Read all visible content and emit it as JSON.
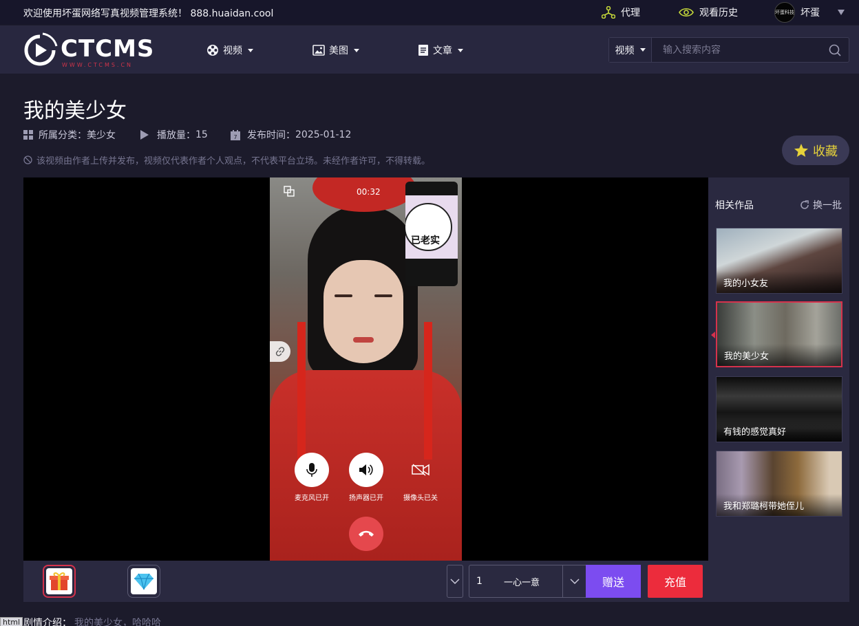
{
  "topbar": {
    "welcome": "欢迎使用坏蛋网络写真视频管理系统！ 888.huaidan.cool",
    "agent_label": "代理",
    "history_label": "观看历史",
    "username": "坏蛋",
    "avatar_text": "坏蛋科技"
  },
  "nav": {
    "logo_text": "CTCMS",
    "logo_sub": "WWW.CTCMS.CN",
    "items": [
      {
        "label": "视频",
        "icon": "film-reel-icon"
      },
      {
        "label": "美图",
        "icon": "image-icon"
      },
      {
        "label": "文章",
        "icon": "document-icon"
      }
    ],
    "search": {
      "type": "视频",
      "placeholder": "输入搜索内容"
    }
  },
  "video": {
    "title": "我的美少女",
    "category_label": "所属分类：",
    "category": "美少女",
    "plays_label": "播放量：",
    "plays": "15",
    "date_label": "发布时间：",
    "date": "2025-01-12",
    "notice": "该视频由作者上传并发布，视频仅代表作者个人观点，不代表平台立场。未经作者许可，不得转载。",
    "favorite": "收藏"
  },
  "player": {
    "timer": "00:32",
    "sticker_text": "已老实",
    "controls": [
      {
        "label": "麦克风已开",
        "icon": "microphone-icon"
      },
      {
        "label": "扬声器已开",
        "icon": "speaker-icon"
      },
      {
        "label": "摄像头已关",
        "icon": "camera-off-icon"
      }
    ]
  },
  "gift_bar": {
    "quantity": "1",
    "quantity_word": "一心一意",
    "send": "赠送",
    "recharge": "充值"
  },
  "sidebar": {
    "heading": "相关作品",
    "refresh": "换一批",
    "items": [
      {
        "title": "我的小女友",
        "active": false
      },
      {
        "title": "我的美少女",
        "active": true
      },
      {
        "title": "有钱的感觉真好",
        "active": false
      },
      {
        "title": "我和郑璐柯带她侄儿",
        "active": false
      }
    ]
  },
  "intro": {
    "label": "剧情介绍：",
    "text": "我的美少女，哈哈哈"
  },
  "debug_tag": "html",
  "colors": {
    "background": "#1c1b2b",
    "nav_bg": "#28273f",
    "accent_purple": "#7c4cf0",
    "accent_red": "#ec2c3c",
    "fav_star": "#e6d23a"
  }
}
